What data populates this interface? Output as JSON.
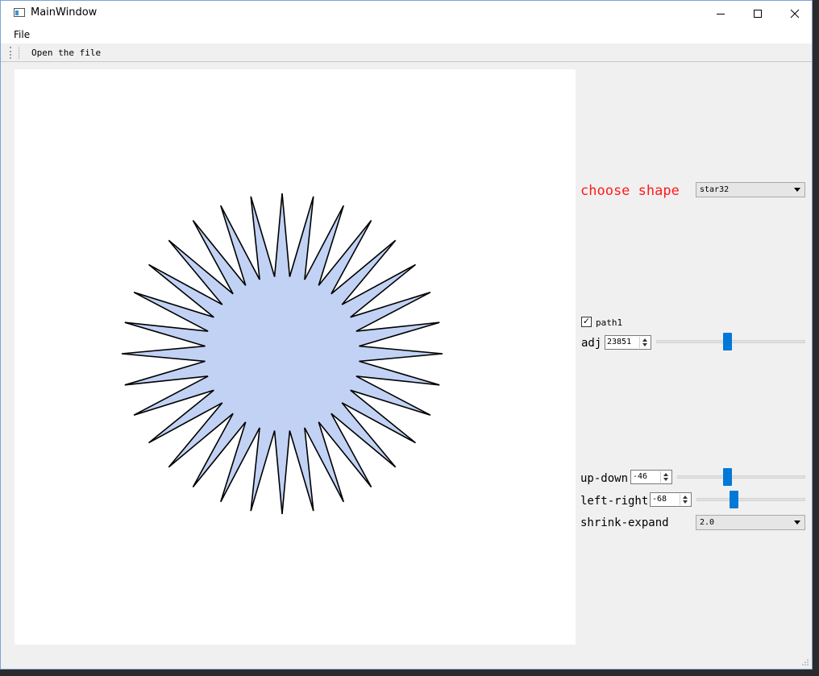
{
  "window": {
    "title": "MainWindow"
  },
  "menubar": {
    "items": [
      "File"
    ]
  },
  "toolbar": {
    "open_label": "Open the file"
  },
  "shape": {
    "points": 32,
    "fill": "#c1d2f5",
    "stroke": "#000000"
  },
  "panel": {
    "choose_label": "choose shape",
    "choose_color": "#ff1a1a",
    "shape_value": "star32",
    "path_label": "path1",
    "path_checked": true,
    "adj_label": "adj",
    "adj_value": "23851",
    "updown_label": "up-down",
    "updown_value": "-46",
    "leftright_label": "left-right",
    "leftright_value": "-68",
    "shrink_label": "shrink-expand",
    "shrink_value": "2.0"
  },
  "colors": {
    "accent": "#0078d7"
  }
}
